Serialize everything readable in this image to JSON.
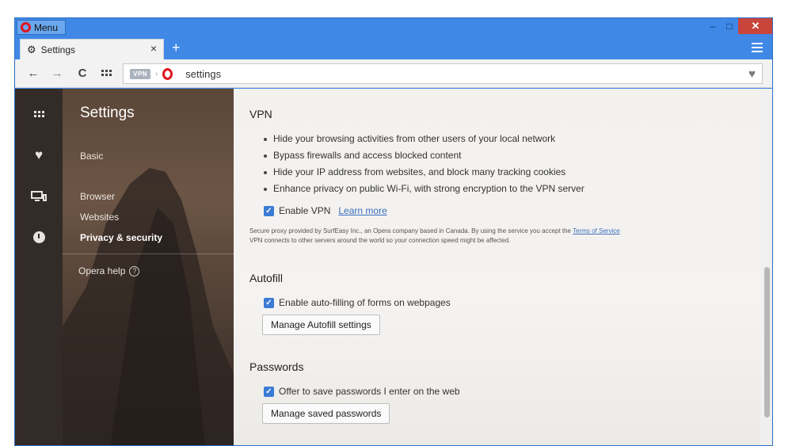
{
  "window": {
    "menu_label": "Menu",
    "minimize": "–",
    "maximize": "□",
    "close": "✕"
  },
  "tab": {
    "title": "Settings",
    "close": "×",
    "new_tab": "+"
  },
  "toolbar": {
    "back": "←",
    "forward": "→",
    "reload": "C",
    "vpn_badge": "VPN",
    "address": "settings",
    "heart": "♥"
  },
  "rail": {
    "icons": [
      "speed-dial-icon",
      "heart-icon",
      "devices-icon",
      "history-icon"
    ],
    "heart": "♥"
  },
  "nav": {
    "title": "Settings",
    "items": {
      "basic": "Basic",
      "browser": "Browser",
      "websites": "Websites",
      "privacy": "Privacy & security"
    },
    "help": "Opera help",
    "help_icon": "?"
  },
  "main": {
    "vpn": {
      "title": "VPN",
      "features": [
        "Hide your browsing activities from other users of your local network",
        "Bypass firewalls and access blocked content",
        "Hide your IP address from websites, and block many tracking cookies",
        "Enhance privacy on public Wi-Fi, with strong encryption to the VPN server"
      ],
      "enable_label": "Enable VPN",
      "learn_more": "Learn more",
      "note_part1": "Secure proxy provided by SurfEasy Inc., an Opera company based in Canada. By using the service you accept the",
      "terms_link": "Terms of Service",
      "note_part2": "VPN connects to other servers around the world so your connection speed might be affected."
    },
    "autofill": {
      "title": "Autofill",
      "enable_label": "Enable auto-filling of forms on webpages",
      "manage_button": "Manage Autofill settings"
    },
    "passwords": {
      "title": "Passwords",
      "offer_label": "Offer to save passwords I enter on the web",
      "manage_button": "Manage saved passwords"
    }
  },
  "colors": {
    "window_frame": "#3f88e6",
    "close_button": "#c9453c",
    "opera_red": "#e0151e",
    "checkbox": "#3a7bd5",
    "link": "#3a6fbe"
  }
}
